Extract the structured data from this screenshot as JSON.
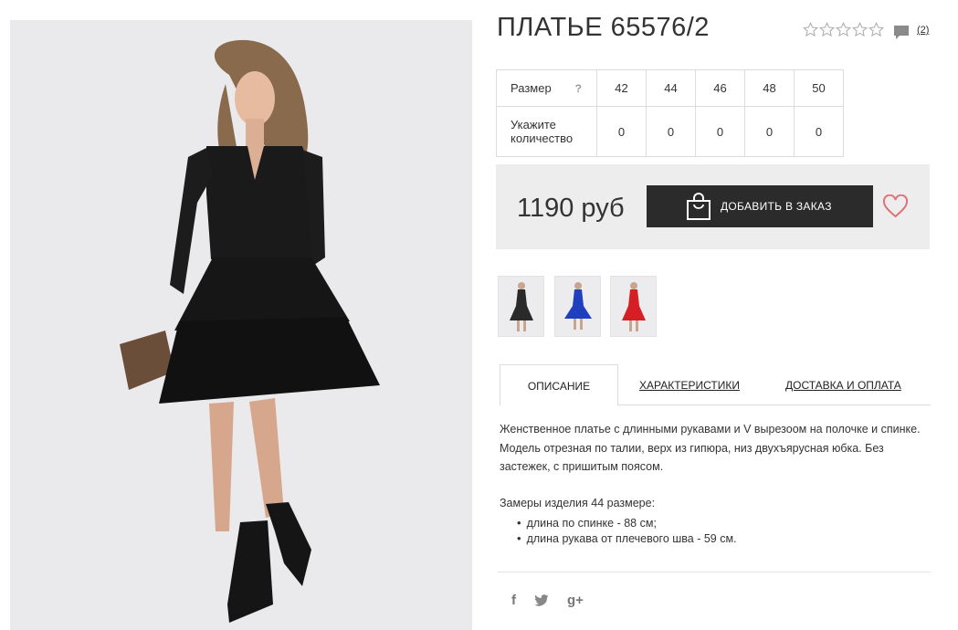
{
  "product": {
    "title": "ПЛАТЬЕ 65576/2",
    "review_count": "(2)",
    "stars_filled": 0,
    "stars_total": 5
  },
  "size_table": {
    "size_label": "Размер",
    "help": "?",
    "sizes": [
      "42",
      "44",
      "46",
      "48",
      "50"
    ],
    "qty_label_line1": "Укажите",
    "qty_label_line2": "количество",
    "quantities": [
      "0",
      "0",
      "0",
      "0",
      "0"
    ]
  },
  "purchase": {
    "price": "1190 руб",
    "add_button_label": "ДОБАВИТЬ В ЗАКАЗ"
  },
  "tabs": [
    {
      "label": "ОПИСАНИЕ",
      "active": true
    },
    {
      "label": "ХАРАКТЕРИСТИКИ",
      "active": false
    },
    {
      "label": "ДОСТАВКА И ОПЛАТА",
      "active": false
    }
  ],
  "description": {
    "text": "Женственное платье с длинными рукавами и V вырезоом на полочке и спинке. Модель отрезная по талии, верх из гипюра, низ двухъярусная юбка. Без застежек, с пришитым поясом.",
    "measures_title": "Замеры изделия 44 размере:",
    "measures": [
      "длина по спинке - 88 см;",
      "длина рукава от плечевого шва - 59 см."
    ]
  },
  "share": {
    "facebook": "f",
    "twitter": "twitter-icon",
    "google_plus": "g+"
  },
  "thumbnails": [
    {
      "color_name": "black",
      "hex": "#2a2a2a"
    },
    {
      "color_name": "blue",
      "hex": "#1f3fbf"
    },
    {
      "color_name": "red",
      "hex": "#d61f25"
    }
  ],
  "colors": {
    "button_bg": "#2b2b2b",
    "price_bar_bg": "#ededed",
    "heart": "#e0707a"
  }
}
